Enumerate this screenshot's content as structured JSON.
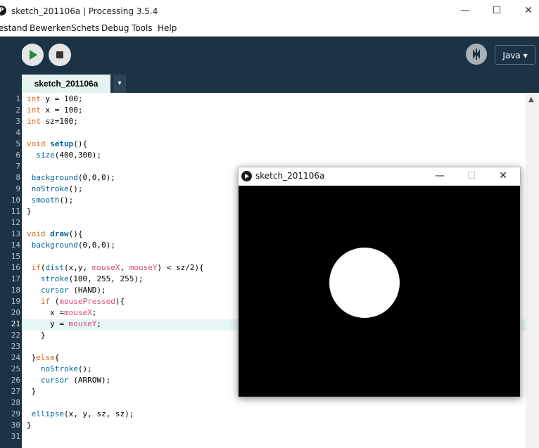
{
  "window": {
    "title": "sketch_201106a | Processing 3.5.4",
    "controls": {
      "minimize": "—",
      "maximize": "☐",
      "close": "✕"
    }
  },
  "menu": [
    "estand",
    "Bewerken",
    "Schets",
    "Debug",
    "Tools",
    "Help"
  ],
  "toolbar": {
    "mode_label": "Java ▾"
  },
  "tabs": {
    "active": "sketch_201106a",
    "menu_glyph": "▾"
  },
  "editor": {
    "current_line": 21,
    "lines": [
      {
        "n": "1",
        "t": "int y = 100;"
      },
      {
        "n": "2",
        "t": "int x = 100;"
      },
      {
        "n": "3",
        "t": "int sz=100;"
      },
      {
        "n": "4",
        "t": ""
      },
      {
        "n": "5",
        "t": "void setup(){"
      },
      {
        "n": "6",
        "t": "  size(400,300);"
      },
      {
        "n": "7",
        "t": ""
      },
      {
        "n": "8",
        "t": " background(0,0,0);"
      },
      {
        "n": "9",
        "t": " noStroke();"
      },
      {
        "n": "10",
        "t": " smooth();"
      },
      {
        "n": "11",
        "t": "}"
      },
      {
        "n": "12",
        "t": ""
      },
      {
        "n": "13",
        "t": "void draw(){"
      },
      {
        "n": "14",
        "t": " background(0,0,0);"
      },
      {
        "n": "15",
        "t": ""
      },
      {
        "n": "16",
        "t": " if(dist(x,y, mouseX, mouseY) < sz/2){"
      },
      {
        "n": "17",
        "t": "   stroke(100, 255, 255);"
      },
      {
        "n": "18",
        "t": "   cursor (HAND);"
      },
      {
        "n": "19",
        "t": "   if (mousePressed){"
      },
      {
        "n": "20",
        "t": "     x =mouseX;"
      },
      {
        "n": "21",
        "t": "     y = mouseY;"
      },
      {
        "n": "22",
        "t": "   }"
      },
      {
        "n": "23",
        "t": ""
      },
      {
        "n": "24",
        "t": " }else{"
      },
      {
        "n": "25",
        "t": "   noStroke();"
      },
      {
        "n": "26",
        "t": "   cursor (ARROW);"
      },
      {
        "n": "27",
        "t": " }"
      },
      {
        "n": "28",
        "t": ""
      },
      {
        "n": "29",
        "t": " ellipse(x, y, sz, sz);"
      },
      {
        "n": "30",
        "t": "}"
      },
      {
        "n": "31",
        "t": ""
      }
    ]
  },
  "sketch_window": {
    "title": "sketch_201106a",
    "controls": {
      "minimize": "—",
      "maximize": "☐",
      "close": "✕"
    }
  },
  "colors": {
    "toolbar_bg": "#1c3245",
    "tab_active": "#e5f3f1",
    "keyword": "#e2661a",
    "function": "#006699",
    "variable": "#d94a7a",
    "canvas_bg": "#000000",
    "ellipse": "#ffffff"
  }
}
